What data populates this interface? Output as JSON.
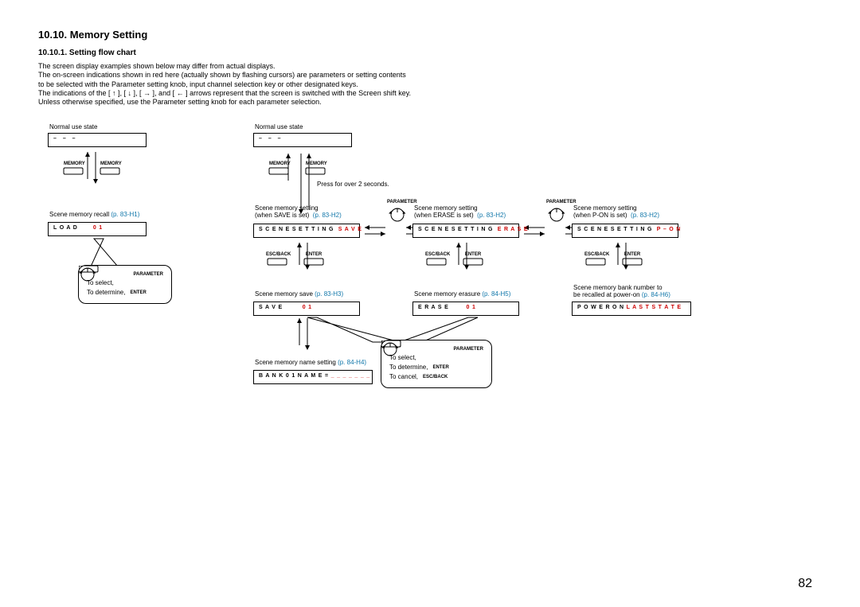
{
  "section": {
    "title": "10.10. Memory Setting",
    "subtitle": "10.10.1. Setting flow chart",
    "para1": "The screen display examples shown below may differ from actual displays.",
    "para2": "The on-screen indications shown in red here (actually shown by flashing cursors) are parameters or setting contents",
    "para3": "to be selected with the Parameter setting knob, input channel selection key or other designated keys.",
    "para4": "The indications of the [ ↑ ], [ ↓ ], [ → ], and [ ← ] arrows represent that the screen is switched with the Screen shift key.",
    "para5": "Unless otherwise specified, use the Parameter setting knob for each parameter selection."
  },
  "page_number": "82",
  "labels": {
    "normal_use": "Normal use state",
    "press2s": "Press for over 2 seconds.",
    "memory": "MEMORY",
    "parameter": "PARAMETER",
    "enter": "ENTER",
    "escback": "ESC/BACK",
    "to_select": "To select,",
    "to_determine": "To determine,",
    "to_cancel": "To cancel,"
  },
  "captions": {
    "scene_recall": "Scene memory recall",
    "scene_recall_ref": "(p. 83-H1)",
    "scene_set_save": "Scene memory setting",
    "scene_set_save2": "(when SAVE is set)",
    "scene_set_save_ref": "(p. 83-H2)",
    "scene_set_erase": "Scene memory setting",
    "scene_set_erase2": "(when ERASE is set)",
    "scene_set_erase_ref": "(p. 83-H2)",
    "scene_set_pon": "Scene memory setting",
    "scene_set_pon2": "(when P-ON is set)",
    "scene_set_pon_ref": "(p. 83-H2)",
    "scene_save": "Scene memory save",
    "scene_save_ref": "(p. 83-H3)",
    "scene_erase": "Scene memory erasure",
    "scene_erase_ref": "(p. 84-H5)",
    "scene_name": "Scene memory name setting",
    "scene_name_ref": "(p. 84-H4)",
    "bank_recall1": "Scene memory bank number to",
    "bank_recall2": "be recalled at power-on",
    "bank_recall_ref": "(p. 84-H6)"
  },
  "screens": {
    "top_left_dashes": "– – –",
    "top_mid_dashes": "– – –",
    "load_a": "L O A D",
    "load_b": "0 1",
    "scset_save_a": "S C E N E S E T T I N G",
    "scset_save_b": "S A V E",
    "scset_erase_a": "S C E N E S E T T I N G",
    "scset_erase_b": "E R A S E",
    "scset_pon_a": "S C E N E S E T T I N G",
    "scset_pon_b": "P – O N",
    "save_a": "S A V E",
    "save_b": "0 1",
    "erase_a": "E R A S E",
    "erase_b": "0 1",
    "name_a": "B A N K 0 1 N A M E =",
    "name_b": "_ _ _ _ _ _ _",
    "power_a": "P O W E R   O N",
    "power_b": "L A S T S T A T E"
  }
}
